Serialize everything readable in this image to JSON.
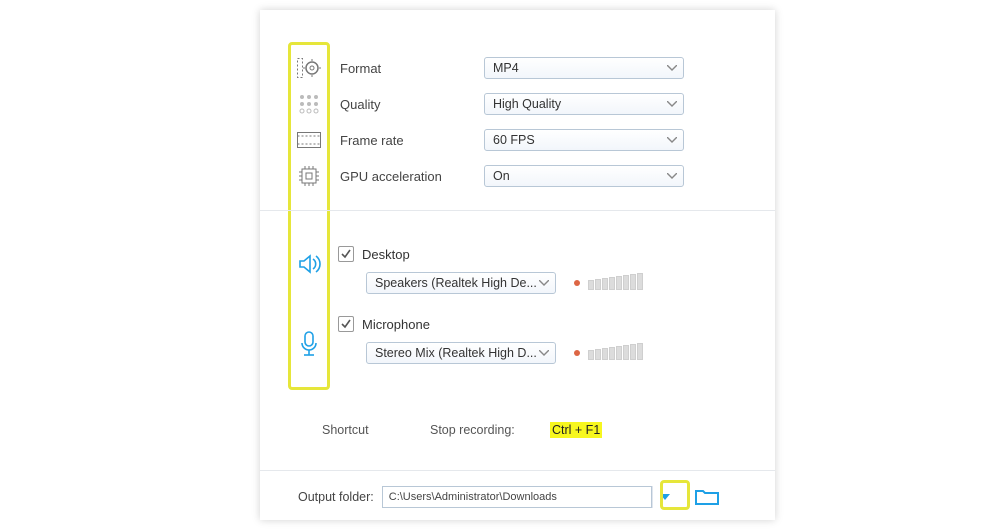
{
  "video": {
    "format": {
      "label": "Format",
      "value": "MP4"
    },
    "quality": {
      "label": "Quality",
      "value": "High Quality"
    },
    "frame_rate": {
      "label": "Frame rate",
      "value": "60 FPS"
    },
    "gpu": {
      "label": "GPU acceleration",
      "value": "On"
    }
  },
  "audio": {
    "desktop": {
      "label": "Desktop",
      "checked": true,
      "device": "Speakers (Realtek High De..."
    },
    "microphone": {
      "label": "Microphone",
      "checked": true,
      "device": "Stereo Mix (Realtek High D..."
    }
  },
  "shortcut": {
    "section_label": "Shortcut",
    "stop_label": "Stop recording:",
    "hotkey": "Ctrl + F1"
  },
  "output": {
    "label": "Output folder:",
    "path": "C:\\Users\\Administrator\\Downloads"
  }
}
